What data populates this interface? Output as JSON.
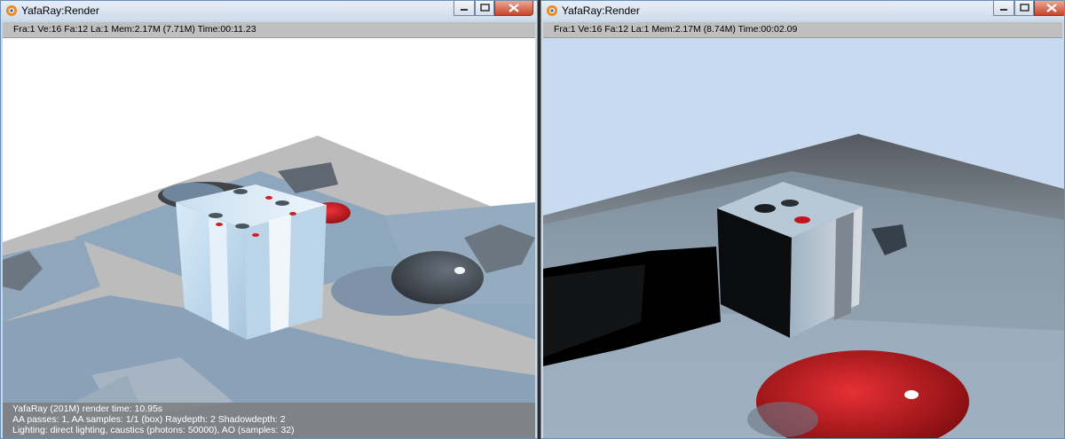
{
  "windows": [
    {
      "title": "YafaRay:Render",
      "status": "Fra:1  Ve:16 Fa:12 La:1 Mem:2.17M (7.71M) Time:00:11.23",
      "info": {
        "line1": "YafaRay (201M)     render time: 10.95s",
        "line2": "AA passes: 1, AA samples: 1/1 (box)   Raydepth: 2   Shadowdepth: 2",
        "line3": "Lighting: direct lighting, caustics (photons: 50000), AO (samples: 32)"
      }
    },
    {
      "title": "YafaRay:Render",
      "status": "Fra:1  Ve:16 Fa:12 La:1 Mem:2.17M (8.74M) Time:00:02.09"
    }
  ],
  "icons": {
    "app": "yafaray-logo-icon",
    "minimize": "minimize-icon",
    "maximize": "maximize-icon",
    "close": "close-icon"
  },
  "colors": {
    "title_bar": "#d8e4f0",
    "status_bar": "#bfbfbf",
    "close_button": "#c7452c",
    "sky_right": "#c7daf0",
    "background_left": "#ffffff"
  }
}
